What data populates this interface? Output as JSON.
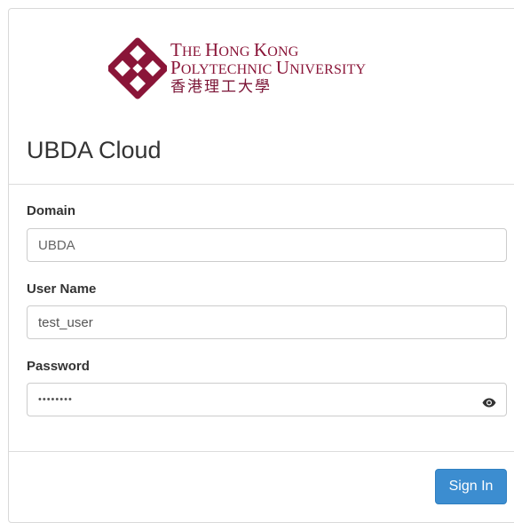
{
  "brand": {
    "line1_a": "T",
    "line1_b": "HE ",
    "line1_c": "H",
    "line1_d": "ONG ",
    "line1_e": "K",
    "line1_f": "ONG",
    "line2_a": "P",
    "line2_b": "OLYTECHNIC ",
    "line2_c": "U",
    "line2_d": "NIVERSITY",
    "line3": "香港理工大學",
    "color": "#8a1538"
  },
  "app_title": "UBDA Cloud",
  "form": {
    "domain_label": "Domain",
    "domain_value": "UBDA",
    "username_label": "User Name",
    "username_value": "test_user",
    "password_label": "Password",
    "password_mask": "••••••••"
  },
  "actions": {
    "sign_in_label": "Sign In",
    "accent": "#3c8dd0"
  },
  "icons": {
    "logo": "polyu-logo-icon",
    "show_password": "eye-icon"
  }
}
